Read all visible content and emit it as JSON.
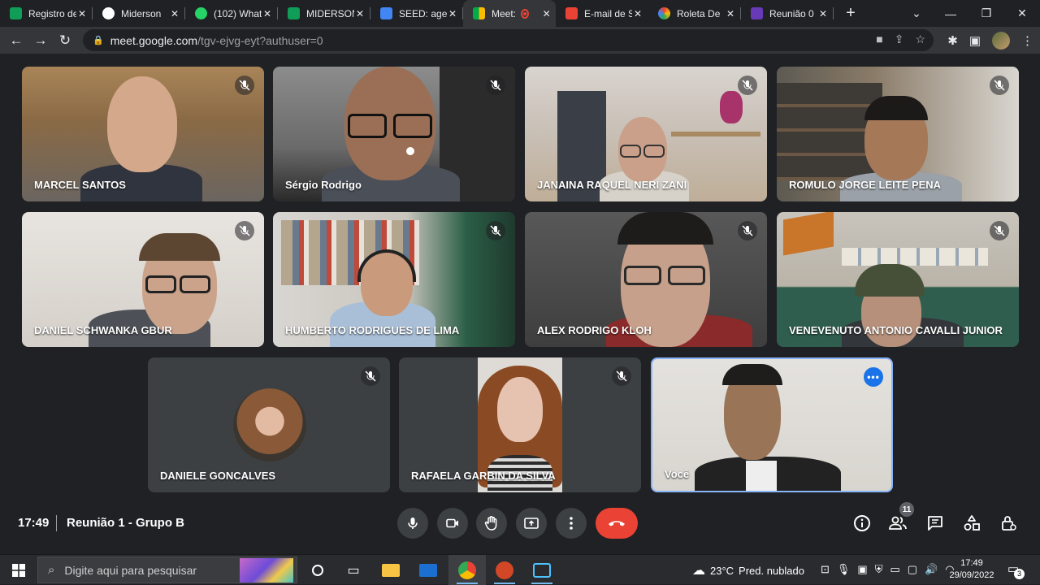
{
  "tabs": [
    {
      "label": "Registro de",
      "icon": "registro-icon",
      "color": "#0f9d58",
      "active": false
    },
    {
      "label": "Miderson",
      "icon": "github-icon",
      "color": "#ffffff",
      "active": false
    },
    {
      "label": "(102) What",
      "icon": "whatsapp-icon",
      "color": "#25d366",
      "active": false
    },
    {
      "label": "MIDERSON",
      "icon": "sheets-icon",
      "color": "#0f9d58",
      "active": false
    },
    {
      "label": "SEED: agen",
      "icon": "seed-icon",
      "color": "#4285f4",
      "active": false
    },
    {
      "label": "Meet:",
      "icon": "meet-icon",
      "color": "#00ac47",
      "active": true
    },
    {
      "label": "E-mail de S",
      "icon": "gmail-icon",
      "color": "#ea4335",
      "active": false
    },
    {
      "label": "Roleta De",
      "icon": "wheel-icon",
      "color": "#fbbc04",
      "active": false
    },
    {
      "label": "Reunião 0",
      "icon": "reuniao-icon",
      "color": "#673ab7",
      "active": false
    }
  ],
  "url": {
    "host": "meet.google.com",
    "path": "/tgv-ejvg-eyt?authuser=0"
  },
  "participants": [
    {
      "name": "MARCEL SANTOS",
      "muted": true
    },
    {
      "name": "Sérgio Rodrigo",
      "muted": true
    },
    {
      "name": "JANAINA RAQUEL NERI ZANI",
      "muted": true
    },
    {
      "name": "ROMULO JORGE LEITE PENA",
      "muted": true
    },
    {
      "name": "DANIEL SCHWANKA GBUR",
      "muted": true
    },
    {
      "name": "HUMBERTO RODRIGUES DE LIMA",
      "muted": true
    },
    {
      "name": "ALEX RODRIGO KLOH",
      "muted": true
    },
    {
      "name": "VENEVENUTO ANTONIO CAVALLI JUNIOR",
      "muted": true
    },
    {
      "name": "DANIELE GONCALVES",
      "muted": true
    },
    {
      "name": "RAFAELA GARBIN DA SILVA",
      "muted": true
    },
    {
      "name": "Você",
      "muted": false
    }
  ],
  "meeting": {
    "time": "17:49",
    "title": "Reunião 1 - Grupo B",
    "participant_count": "11"
  },
  "taskbar": {
    "search_placeholder": "Digite aqui para pesquisar",
    "weather_temp": "23°C",
    "weather_desc": "Pred. nublado",
    "clock_time": "17:49",
    "clock_date": "29/09/2022",
    "notification_count": "3"
  },
  "colors": {
    "accent": "#8ab4f8",
    "end_call": "#ea4335",
    "tile_bg": "#3c4043",
    "page_bg": "#202124"
  }
}
